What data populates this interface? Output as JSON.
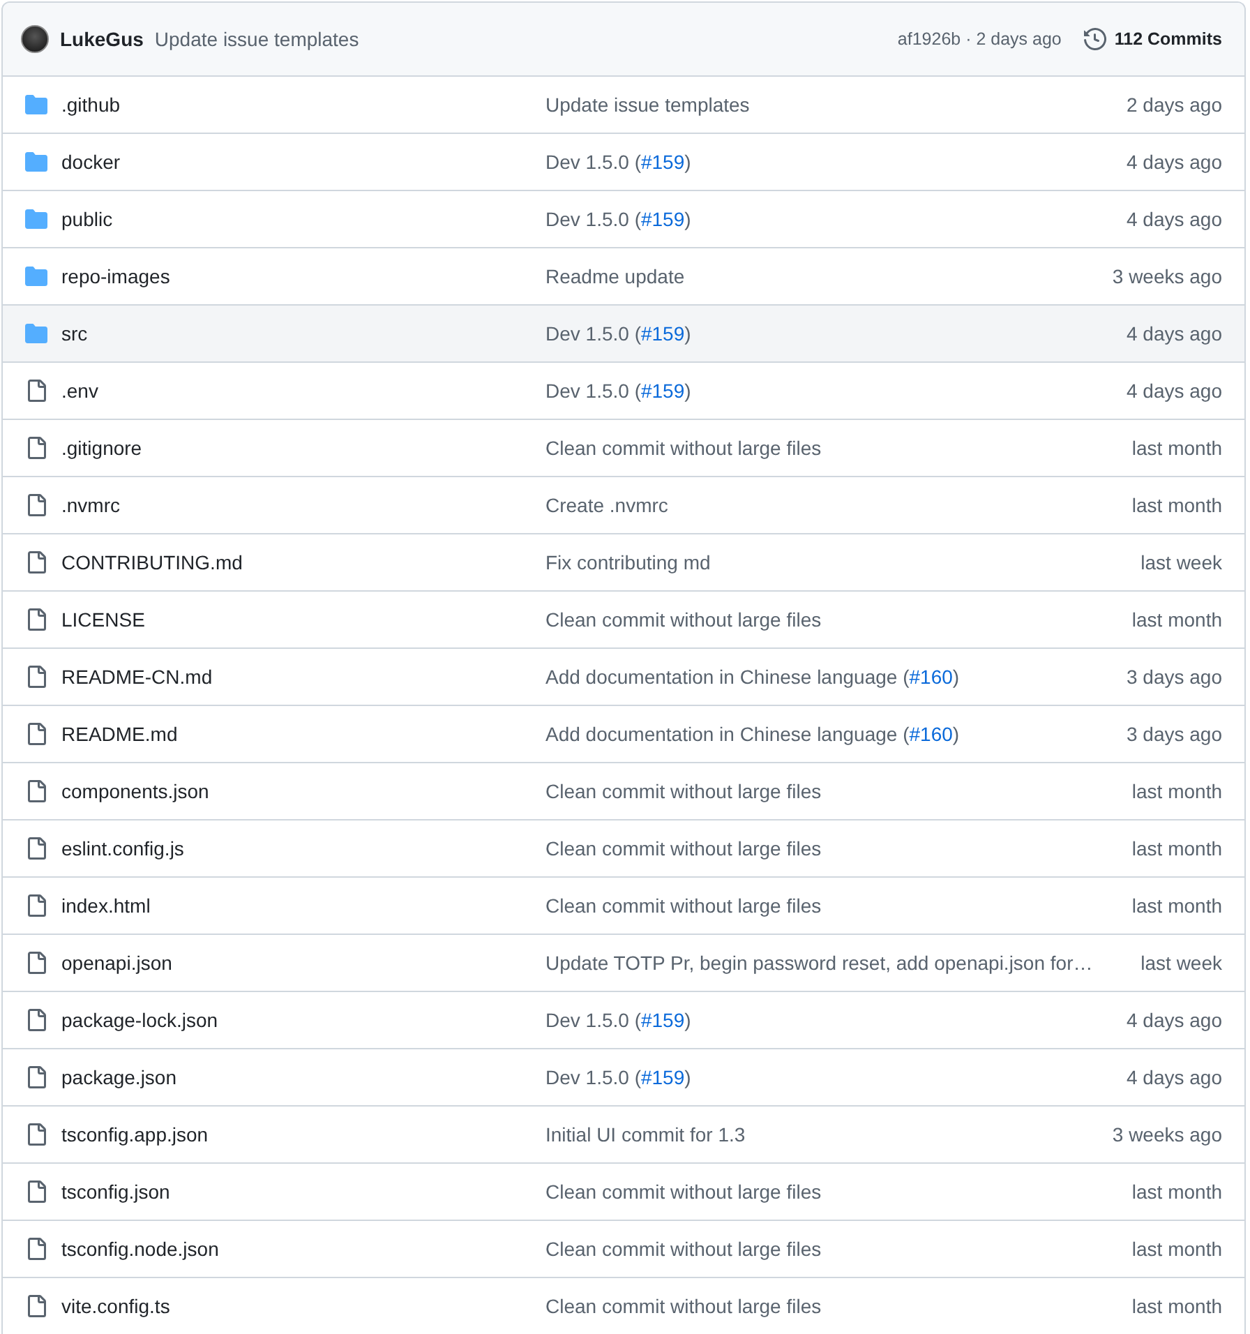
{
  "latest_commit": {
    "author": "LukeGus",
    "message": "Update issue templates",
    "hash_time": "af1926b · 2 days ago",
    "commits": "112 Commits"
  },
  "files": [
    {
      "kind": "folder",
      "name": ".github",
      "message": "Update issue templates",
      "date": "2 days ago",
      "hovered": false
    },
    {
      "kind": "folder",
      "name": "docker",
      "message": "Dev 1.5.0 (",
      "link": "#159",
      "message_end": ")",
      "date": "4 days ago",
      "hovered": false
    },
    {
      "kind": "folder",
      "name": "public",
      "message": "Dev 1.5.0 (",
      "link": "#159",
      "message_end": ")",
      "date": "4 days ago",
      "hovered": false
    },
    {
      "kind": "folder",
      "name": "repo-images",
      "message": "Readme update",
      "date": "3 weeks ago",
      "hovered": false
    },
    {
      "kind": "folder",
      "name": "src",
      "message": "Dev 1.5.0 (",
      "link": "#159",
      "message_end": ")",
      "date": "4 days ago",
      "hovered": true
    },
    {
      "kind": "file",
      "name": ".env",
      "message": "Dev 1.5.0 (",
      "link": "#159",
      "message_end": ")",
      "date": "4 days ago",
      "hovered": false
    },
    {
      "kind": "file",
      "name": ".gitignore",
      "message": "Clean commit without large files",
      "date": "last month",
      "hovered": false
    },
    {
      "kind": "file",
      "name": ".nvmrc",
      "message": "Create .nvmrc",
      "date": "last month",
      "hovered": false
    },
    {
      "kind": "file",
      "name": "CONTRIBUTING.md",
      "message": "Fix contributing md",
      "date": "last week",
      "hovered": false
    },
    {
      "kind": "file",
      "name": "LICENSE",
      "message": "Clean commit without large files",
      "date": "last month",
      "hovered": false
    },
    {
      "kind": "file",
      "name": "README-CN.md",
      "message": "Add documentation in Chinese language (",
      "link": "#160",
      "message_end": ")",
      "date": "3 days ago",
      "hovered": false
    },
    {
      "kind": "file",
      "name": "README.md",
      "message": "Add documentation in Chinese language (",
      "link": "#160",
      "message_end": ")",
      "date": "3 days ago",
      "hovered": false
    },
    {
      "kind": "file",
      "name": "components.json",
      "message": "Clean commit without large files",
      "date": "last month",
      "hovered": false
    },
    {
      "kind": "file",
      "name": "eslint.config.js",
      "message": "Clean commit without large files",
      "date": "last month",
      "hovered": false
    },
    {
      "kind": "file",
      "name": "index.html",
      "message": "Clean commit without large files",
      "date": "last month",
      "hovered": false
    },
    {
      "kind": "file",
      "name": "openapi.json",
      "message": "Update TOTP Pr, begin password reset, add openapi.json for…",
      "date": "last week",
      "hovered": false
    },
    {
      "kind": "file",
      "name": "package-lock.json",
      "message": "Dev 1.5.0 (",
      "link": "#159",
      "message_end": ")",
      "date": "4 days ago",
      "hovered": false
    },
    {
      "kind": "file",
      "name": "package.json",
      "message": "Dev 1.5.0 (",
      "link": "#159",
      "message_end": ")",
      "date": "4 days ago",
      "hovered": false
    },
    {
      "kind": "file",
      "name": "tsconfig.app.json",
      "message": "Initial UI commit for 1.3",
      "date": "3 weeks ago",
      "hovered": false
    },
    {
      "kind": "file",
      "name": "tsconfig.json",
      "message": "Clean commit without large files",
      "date": "last month",
      "hovered": false
    },
    {
      "kind": "file",
      "name": "tsconfig.node.json",
      "message": "Clean commit without large files",
      "date": "last month",
      "hovered": false
    },
    {
      "kind": "file",
      "name": "vite.config.ts",
      "message": "Clean commit without large files",
      "date": "last month",
      "hovered": false
    }
  ]
}
